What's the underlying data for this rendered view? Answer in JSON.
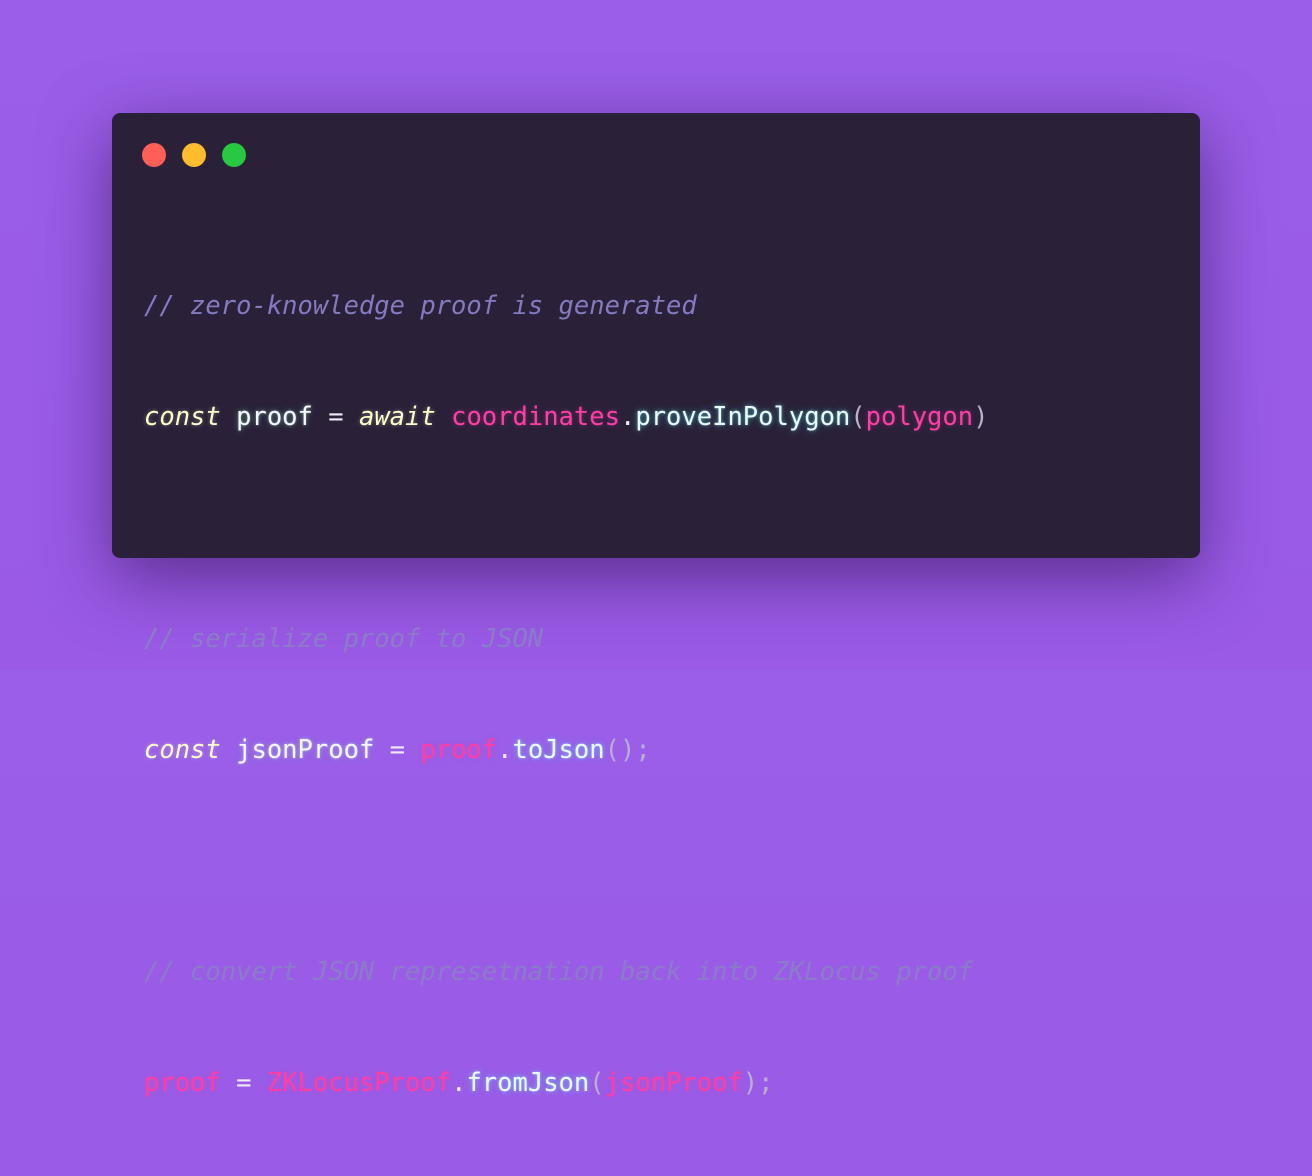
{
  "window_controls": {
    "close_color": "#ff5f57",
    "minimize_color": "#febc2e",
    "maximize_color": "#28c840"
  },
  "code": {
    "line1": {
      "comment": "// zero-knowledge proof is generated"
    },
    "line2": {
      "keyword": "const",
      "variable": "proof",
      "operator": "=",
      "await": "await",
      "object": "coordinates",
      "dot": ".",
      "method": "proveInPolygon",
      "paren_open": "(",
      "arg": "polygon",
      "paren_close": ")"
    },
    "line3": {
      "comment": "// serialize proof to JSON"
    },
    "line4": {
      "keyword": "const",
      "variable": "jsonProof",
      "operator": "=",
      "object": "proof",
      "dot": ".",
      "method": "toJson",
      "call": "();"
    },
    "line5": {
      "comment": "// convert JSON represetnation back into ZKLocus proof"
    },
    "line6": {
      "variable": "proof",
      "operator": "=",
      "object": "ZKLocusProof",
      "dot": ".",
      "method": "fromJson",
      "paren_open": "(",
      "arg": "jsonProof",
      "close": ");"
    }
  }
}
